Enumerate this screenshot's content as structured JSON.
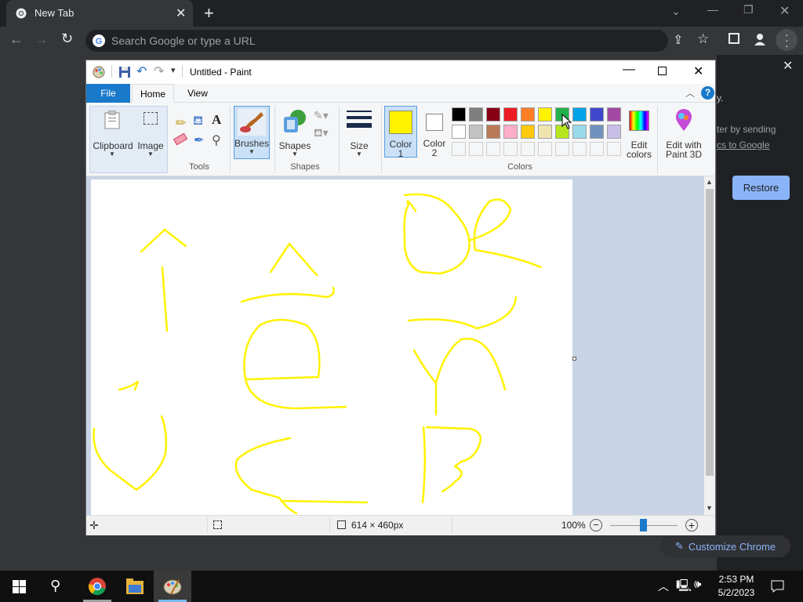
{
  "browser": {
    "tab_title": "New Tab",
    "omnibox_placeholder": "Search Google or type a URL",
    "side_text_1": "y.",
    "side_text_2": "ter by sending",
    "side_text_3": "cs to Google",
    "restore_label": "Restore",
    "customize_label": "Customize Chrome"
  },
  "paint": {
    "title": "Untitled - Paint",
    "tabs": [
      "File",
      "Home",
      "View"
    ],
    "clipboard_label": "Clipboard",
    "image_label": "Image",
    "tools_label": "Tools",
    "brushes_label": "Brushes",
    "shapes_label": "Shapes",
    "shapes_group_label": "Shapes",
    "size_label": "Size",
    "color1_label": "Color",
    "color1_num": "1",
    "color2_label": "Color",
    "color2_num": "2",
    "colors_group_label": "Colors",
    "edit_colors_label_1": "Edit",
    "edit_colors_label_2": "colors",
    "paint3d_label_1": "Edit with",
    "paint3d_label_2": "Paint 3D",
    "canvas_size": "614 × 460px",
    "zoom": "100%",
    "palette_row1": [
      "#000000",
      "#7f7f7f",
      "#880015",
      "#ed1c24",
      "#ff7f27",
      "#fff200",
      "#22b14c",
      "#00a2e8",
      "#3f48cc",
      "#a349a4"
    ],
    "palette_row2": [
      "#ffffff",
      "#c3c3c3",
      "#b97a57",
      "#ffaec9",
      "#ffc90e",
      "#efe4b0",
      "#b5e61d",
      "#99d9ea",
      "#7092be",
      "#c8bfe7"
    ],
    "color1_value": "#fff200",
    "color2_value": "#ffffff"
  },
  "taskbar": {
    "time": "2:53 PM",
    "date": "5/2/2023"
  }
}
